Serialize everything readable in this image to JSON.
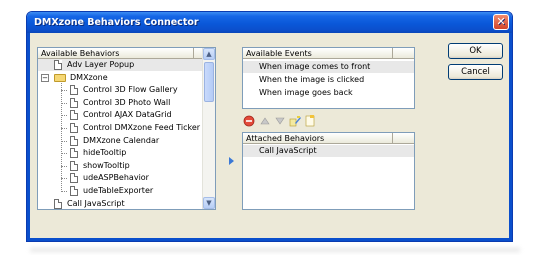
{
  "window": {
    "title": "DMXzone Behaviors Connector",
    "close_glyph": "✕"
  },
  "available_behaviors": {
    "header": "Available Behaviors",
    "items": [
      {
        "label": "Adv Layer Popup",
        "level": 1,
        "icon": "document-icon"
      },
      {
        "label": "DMXzone",
        "level": 1,
        "icon": "folder-icon",
        "expander": "−"
      },
      {
        "label": "Control 3D Flow Gallery",
        "level": 2,
        "icon": "document-icon"
      },
      {
        "label": "Control 3D Photo Wall",
        "level": 2,
        "icon": "document-icon"
      },
      {
        "label": "Control AJAX DataGrid",
        "level": 2,
        "icon": "document-icon"
      },
      {
        "label": "Control DMXzone Feed Ticker",
        "level": 2,
        "icon": "document-icon"
      },
      {
        "label": "DMXzone Calendar",
        "level": 2,
        "icon": "document-icon"
      },
      {
        "label": "hideTooltip",
        "level": 2,
        "icon": "document-icon"
      },
      {
        "label": "showTooltip",
        "level": 2,
        "icon": "document-icon"
      },
      {
        "label": "udeASPBehavior",
        "level": 2,
        "icon": "document-icon"
      },
      {
        "label": "udeTableExporter",
        "level": 2,
        "icon": "document-icon"
      },
      {
        "label": "Call JavaScript",
        "level": 1,
        "icon": "document-icon"
      }
    ],
    "scroll_up": "▲",
    "scroll_down": "▼"
  },
  "available_events": {
    "header": "Available Events",
    "items": [
      "When image comes to front",
      "When the image is clicked",
      "When image goes back"
    ]
  },
  "toolbar": {
    "remove_icon": "remove-icon",
    "move_up_icon": "move-up-icon",
    "move_down_icon": "move-down-icon",
    "edit_icon": "edit-icon",
    "new_icon": "new-document-icon"
  },
  "attached_behaviors": {
    "header": "Attached Behaviors",
    "items": [
      "Call JavaScript"
    ]
  },
  "buttons": {
    "ok": "OK",
    "cancel": "Cancel"
  },
  "colors": {
    "titlebar": "#0a58d9",
    "dialog_bg": "#ece9d8",
    "selection": "#e8e8e8"
  }
}
